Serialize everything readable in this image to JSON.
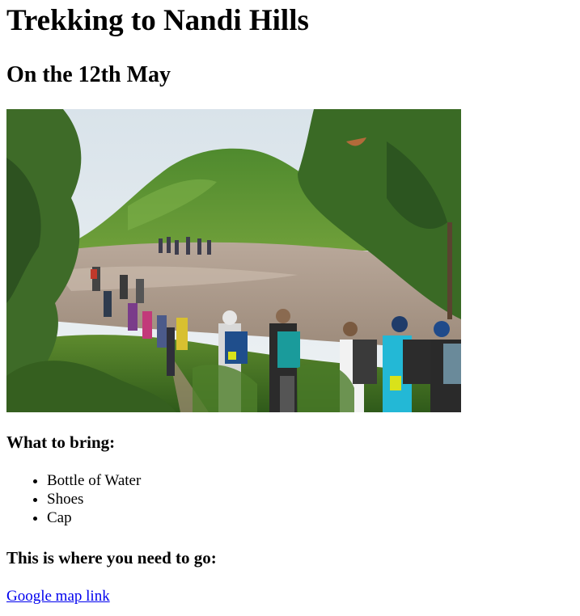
{
  "page": {
    "title": "Trekking to Nandi Hills",
    "subtitle": "On the 12th May"
  },
  "photo": {
    "icon": "trekking-photo"
  },
  "bring": {
    "heading": "What to bring:",
    "items": [
      "Bottle of Water",
      "Shoes",
      "Cap"
    ]
  },
  "location": {
    "heading": "This is where you need to go:",
    "link_text": "Google map link",
    "link_color": "#0000ee"
  }
}
